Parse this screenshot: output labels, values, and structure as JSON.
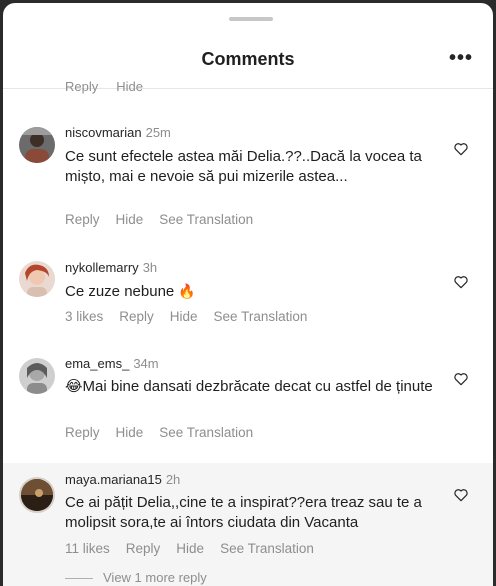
{
  "header": {
    "title": "Comments",
    "more_icon": "more-horizontal-icon"
  },
  "cut_actions": {
    "reply": "Reply",
    "hide": "Hide"
  },
  "comments": [
    {
      "username": "niscovmarian",
      "time": "25m",
      "text": "Ce sunt efectele astea măi Delia.??..Dacă la vocea ta mișto, mai e nevoie să pui mizerile astea...",
      "likes": "",
      "reply": "Reply",
      "hide": "Hide",
      "see_translation": "See Translation"
    },
    {
      "username": "nykollemarry",
      "time": "3h",
      "text": "Ce zuze nebune",
      "emoji": "🔥",
      "likes": "3 likes",
      "reply": "Reply",
      "hide": "Hide",
      "see_translation": "See Translation"
    },
    {
      "username": "ema_ems_",
      "time": "34m",
      "emoji": "😂",
      "text": "Mai bine dansati dezbrăcate decat cu astfel de ținute",
      "likes": "",
      "reply": "Reply",
      "hide": "Hide",
      "see_translation": "See Translation"
    },
    {
      "username": "maya.mariana15",
      "time": "2h",
      "text": "Ce ai pățit Delia,,cine te a inspirat??era treaz sau te a molipsit sora,te ai întors ciudata din Vacanta",
      "likes": "11 likes",
      "reply": "Reply",
      "hide": "Hide",
      "see_translation": "See Translation"
    }
  ],
  "view_more": "View 1 more reply"
}
